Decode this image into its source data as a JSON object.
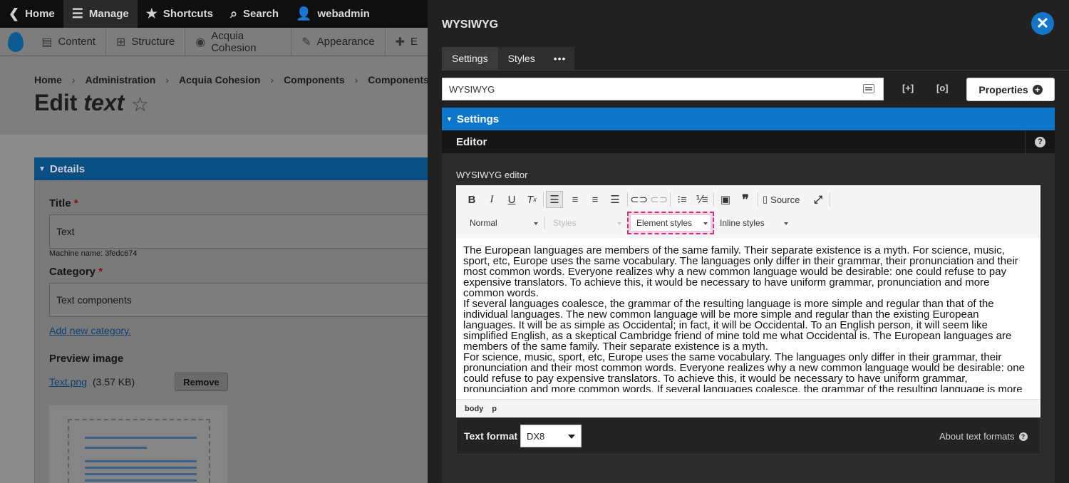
{
  "admin_toolbar": {
    "items": [
      "Home",
      "Manage",
      "Shortcuts",
      "Search",
      "webadmin"
    ]
  },
  "secondary_toolbar": {
    "items": [
      "Content",
      "Structure",
      "Acquia Cohesion",
      "Appearance",
      "E"
    ]
  },
  "breadcrumb": [
    "Home",
    "Administration",
    "Acquia Cohesion",
    "Components",
    "Components"
  ],
  "page": {
    "title_prefix": "Edit ",
    "title_emph": "text"
  },
  "details": {
    "heading": "Details",
    "title_label": "Title",
    "title_value": "Text",
    "machine_name": "Machine name: 3fedc674",
    "category_label": "Category",
    "category_value": "Text components",
    "add_category_link": "Add new category.",
    "preview_label": "Preview image",
    "preview_file": "Text.png",
    "preview_size": "(3.57 KB)",
    "remove_label": "Remove"
  },
  "panel": {
    "title": "WYSIWYG",
    "tabs": [
      "Settings",
      "Styles",
      "•••"
    ],
    "name_value": "WYSIWYG",
    "icon_expand": "[+]",
    "icon_collapse": "[o]",
    "properties_label": "Properties",
    "settings_heading": "Settings",
    "editor_heading": "Editor",
    "editor_label": "WYSIWYG editor",
    "source_label": "Source",
    "combos": {
      "format": "Normal",
      "styles": "Styles",
      "element_styles": "Element styles",
      "inline_styles": "Inline styles"
    },
    "content": [
      "The European languages are members of the same family. Their separate existence is a myth. For science, music, sport, etc, Europe uses the same vocabulary. The languages only differ in their grammar, their pronunciation and their most common words. Everyone realizes why a new common language would be desirable: one could refuse to pay expensive translators. To achieve this, it would be necessary to have uniform grammar, pronunciation and more common words.",
      "If several languages coalesce, the grammar of the resulting language is more simple and regular than that of the individual languages. The new common language will be more simple and regular than the existing European languages. It will be as simple as Occidental; in fact, it will be Occidental. To an English person, it will seem like simplified English, as a skeptical Cambridge friend of mine told me what Occidental is. The European languages are members of the same family. Their separate existence is a myth.",
      "For science, music, sport, etc, Europe uses the same vocabulary. The languages only differ in their grammar, their pronunciation and their most common words. Everyone realizes why a new common language would be desirable: one could refuse to pay expensive translators. To achieve this, it would be necessary to have uniform grammar, pronunciation and more common words. If several languages coalesce, the grammar of the resulting language is more"
    ],
    "path": [
      "body",
      "p"
    ],
    "text_format_label": "Text format",
    "text_format_value": "DX8",
    "about_formats": "About text formats"
  },
  "colors": {
    "panel_bg": "#212121",
    "accent_blue": "#0e76c9",
    "highlight_pink": "#d0307a"
  }
}
